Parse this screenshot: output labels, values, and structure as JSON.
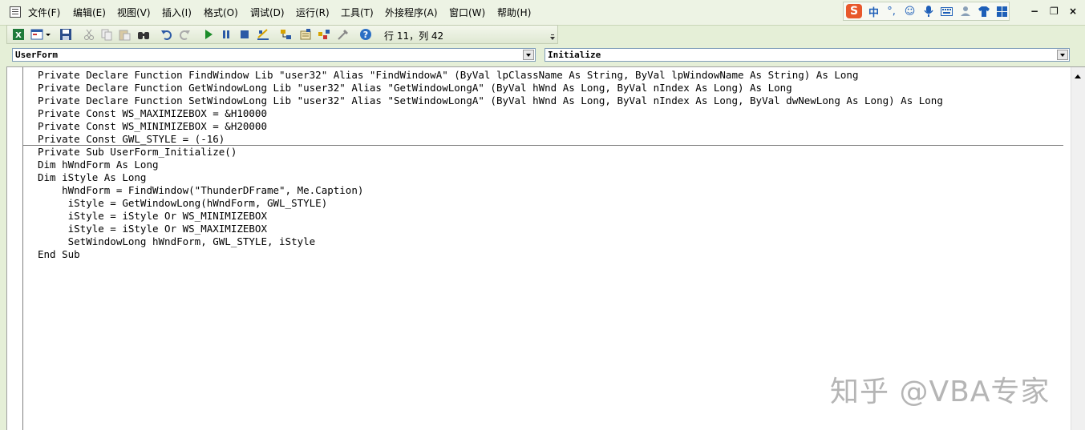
{
  "menubar": {
    "items": [
      "文件(F)",
      "编辑(E)",
      "视图(V)",
      "插入(I)",
      "格式(O)",
      "调试(D)",
      "运行(R)",
      "工具(T)",
      "外接程序(A)",
      "窗口(W)",
      "帮助(H)"
    ]
  },
  "ime": {
    "logo": "S",
    "lang": "中"
  },
  "window_controls": {
    "minimize": "−",
    "restore": "❐",
    "close": "×"
  },
  "toolbar": {
    "status": "行 11，列 42",
    "icons": [
      "excel-icon",
      "userform-icon",
      "save-icon",
      "cut-icon",
      "copy-icon",
      "paste-icon",
      "find-icon",
      "undo-icon",
      "redo-icon",
      "run-icon",
      "break-icon",
      "reset-icon",
      "design-mode-icon",
      "project-explorer-icon",
      "properties-icon",
      "object-browser-icon",
      "toolbox-icon",
      "help-icon"
    ]
  },
  "selectors": {
    "object": "UserForm",
    "procedure": "Initialize"
  },
  "code": {
    "declarations": [
      "Private Declare Function FindWindow Lib \"user32\" Alias \"FindWindowA\" (ByVal lpClassName As String, ByVal lpWindowName As String) As Long",
      "Private Declare Function GetWindowLong Lib \"user32\" Alias \"GetWindowLongA\" (ByVal hWnd As Long, ByVal nIndex As Long) As Long",
      "Private Declare Function SetWindowLong Lib \"user32\" Alias \"SetWindowLongA\" (ByVal hWnd As Long, ByVal nIndex As Long, ByVal dwNewLong As Long) As Long",
      "Private Const WS_MAXIMIZEBOX = &H10000",
      "Private Const WS_MINIMIZEBOX = &H20000",
      "Private Const GWL_STYLE = (-16)"
    ],
    "procedure": [
      "Private Sub UserForm_Initialize()",
      "Dim hWndForm As Long",
      "Dim iStyle As Long",
      "    hWndForm = FindWindow(\"ThunderDFrame\", Me.Caption)",
      "     iStyle = GetWindowLong(hWndForm, GWL_STYLE)",
      "     iStyle = iStyle Or WS_MINIMIZEBOX",
      "     iStyle = iStyle Or WS_MAXIMIZEBOX",
      "     SetWindowLong hWndForm, GWL_STYLE, iStyle",
      "End Sub"
    ]
  },
  "watermark": "知乎 @VBA专家"
}
